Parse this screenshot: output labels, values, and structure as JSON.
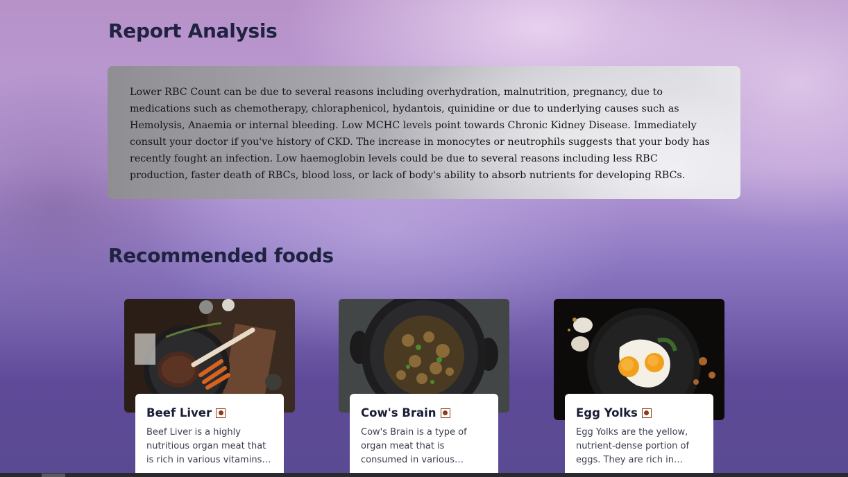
{
  "report": {
    "title": "Report Analysis",
    "text": "Lower RBC Count can be due to several reasons including overhydration, malnutrition, pregnancy, due to medications such as chemotherapy, chloraphenicol, hydantois, quinidine or due to underlying causes such as Hemolysis, Anaemia or internal bleeding. Low MCHC levels point towards Chronic Kidney Disease. Immediately consult your doctor if you've history of CKD. The increase in monocytes or neutrophils suggests that your body has recently fought an infection. Low haemoglobin levels could be due to several reasons including less RBC production, faster death of RBCs, blood loss, or lack of body's ability to absorb nutrients for developing RBCs."
  },
  "foods": {
    "title": "Recommended foods",
    "items": [
      {
        "name": "Beef Liver",
        "icon": "non-veg-icon",
        "description": "Beef Liver is a highly nutritious organ meat that is rich in various vitamins and minerals."
      },
      {
        "name": "Cow's Brain",
        "icon": "non-veg-icon",
        "description": "Cow's Brain is a type of organ meat that is consumed in various cuisines. It is a rich source of nutrients."
      },
      {
        "name": "Egg Yolks",
        "icon": "non-veg-icon",
        "description": "Egg Yolks are the yellow, nutrient-dense portion of eggs. They are rich in various nutrients."
      }
    ]
  },
  "colors": {
    "heading": "#1f2340",
    "non_veg_marker": "#8b3a1a",
    "card_bg": "#ffffff"
  }
}
